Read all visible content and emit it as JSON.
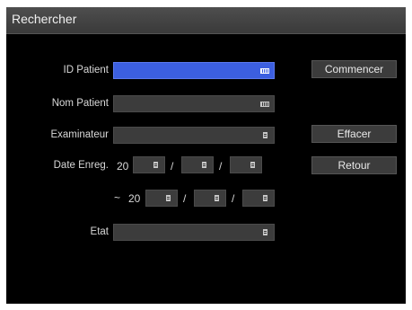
{
  "window": {
    "title": "Rechercher"
  },
  "fields": {
    "id_patient": {
      "label": "ID Patient",
      "value": ""
    },
    "nom_patient": {
      "label": "Nom Patient",
      "value": ""
    },
    "examinateur": {
      "label": "Examinateur",
      "value": ""
    },
    "date_enreg": {
      "label": "Date Enreg.",
      "from_prefix": "20",
      "to_prefix": "20",
      "range_symbol": "~",
      "separator": "/"
    },
    "etat": {
      "label": "Etat",
      "value": ""
    }
  },
  "buttons": {
    "commencer": "Commencer",
    "effacer": "Effacer",
    "retour": "Retour"
  },
  "icons": {
    "keyboard": "keyboard-icon",
    "dropdown": "list-icon"
  },
  "colors": {
    "active_field": "#3c5fe0",
    "background": "#000000",
    "field": "#3c3c3c"
  }
}
